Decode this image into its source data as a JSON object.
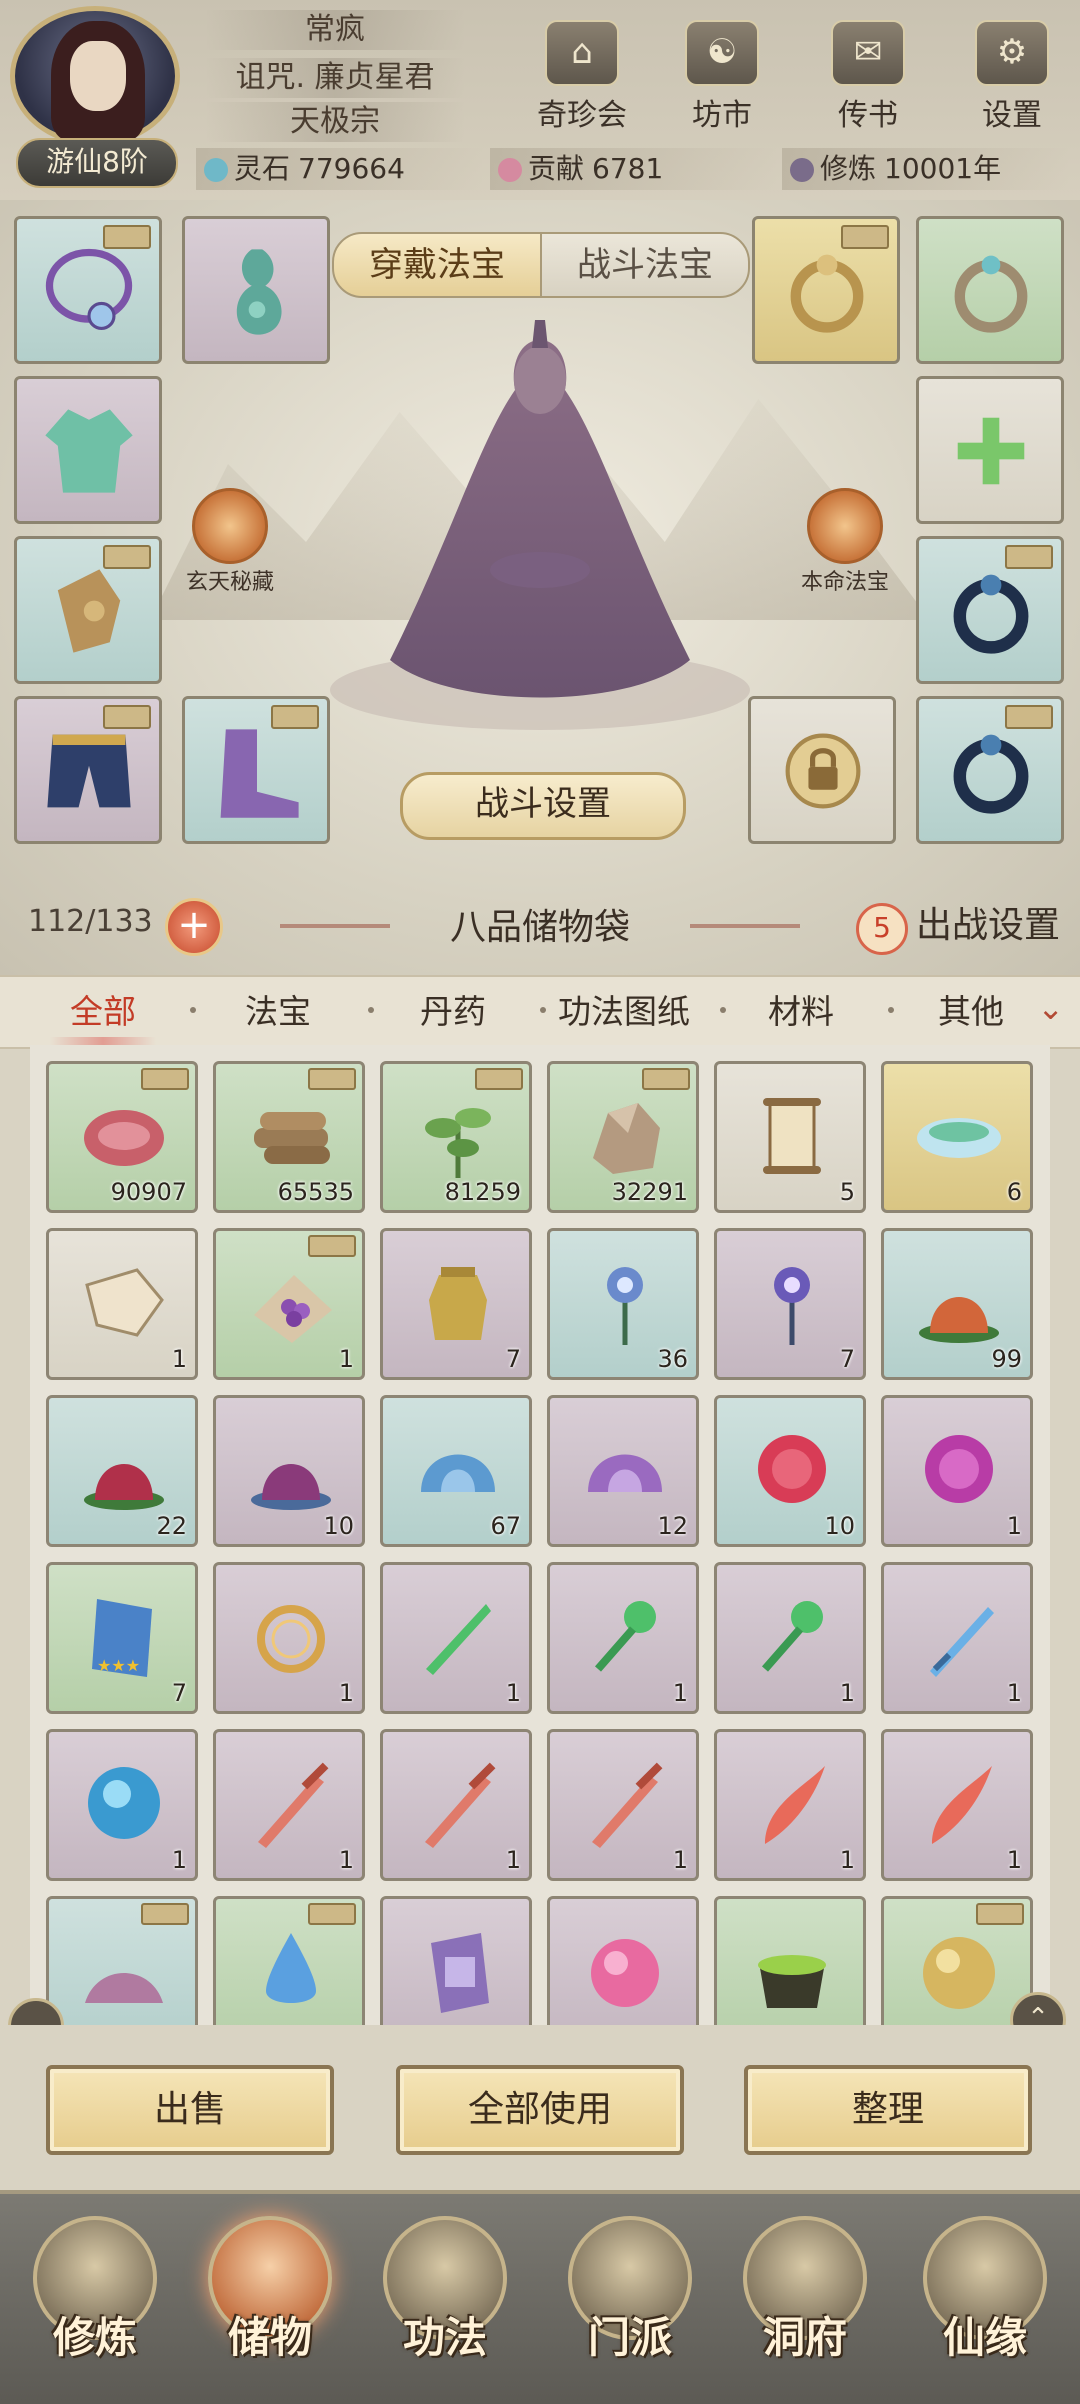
{
  "player": {
    "name": "常疯",
    "title": "诅咒. 廉贞星君",
    "sect": "天极宗",
    "rank": "游仙8阶"
  },
  "top_nav": [
    {
      "label": "奇珍会",
      "icon": "treasure-pavilion-icon"
    },
    {
      "label": "坊市",
      "icon": "market-icon"
    },
    {
      "label": "传书",
      "icon": "scroll-letter-icon"
    },
    {
      "label": "设置",
      "icon": "gear-icon"
    }
  ],
  "resources": [
    {
      "name": "灵石",
      "value": "779664",
      "color": "#6fb8c8"
    },
    {
      "name": "贡献",
      "value": "6781",
      "color": "#d58aa0"
    },
    {
      "name": "修炼",
      "value": "10001年",
      "color": "#7a6c8a"
    }
  ],
  "equip_tabs": {
    "active": "穿戴法宝",
    "inactive": "战斗法宝"
  },
  "equip_slots": {
    "necklace": "necklace-icon",
    "gourd": "gourd-icon",
    "robe": "robe-icon",
    "bracer": "bracer-icon",
    "pants": "pants-icon",
    "boots": "boots-icon",
    "ring_gold": "gold-ring-icon",
    "ring_plain": "ring-icon",
    "add": "+",
    "ring_dark1": "dark-ring-icon",
    "lock": "lock-icon",
    "ring_dark2": "dark-ring-icon"
  },
  "medals": {
    "left": "玄天秘藏",
    "right": "本命法宝"
  },
  "battle_settings": "战斗设置",
  "bag": {
    "capacity": "112/133",
    "title": "八品储物袋",
    "deploy_count": "5",
    "deploy_label": "出战设置"
  },
  "categories": {
    "items": [
      "全部",
      "法宝",
      "丹药",
      "功法图纸",
      "材料",
      "其他"
    ],
    "active_index": 0,
    "more_icon": "chevron-down-icon"
  },
  "items": [
    {
      "art": "meat",
      "count": "90907",
      "bg": "green",
      "tag": true
    },
    {
      "art": "logs",
      "count": "65535",
      "bg": "green",
      "tag": true
    },
    {
      "art": "herb",
      "count": "81259",
      "bg": "green",
      "tag": true
    },
    {
      "art": "ore",
      "count": "32291",
      "bg": "green",
      "tag": true
    },
    {
      "art": "scroll",
      "count": "5",
      "bg": "plain",
      "tag": false
    },
    {
      "art": "bowl",
      "count": "6",
      "bg": "gold",
      "tag": false
    },
    {
      "art": "talisman",
      "count": "1",
      "bg": "plain",
      "tag": false
    },
    {
      "art": "grapes",
      "count": "1",
      "bg": "green",
      "tag": true
    },
    {
      "art": "jar",
      "count": "7",
      "bg": "purple",
      "tag": false
    },
    {
      "art": "flower-blue",
      "count": "36",
      "bg": "blue",
      "tag": false
    },
    {
      "art": "flower-purple",
      "count": "7",
      "bg": "purple",
      "tag": false
    },
    {
      "art": "urchin-orange",
      "count": "99",
      "bg": "blue",
      "tag": false
    },
    {
      "art": "urchin-red",
      "count": "22",
      "bg": "blue",
      "tag": false
    },
    {
      "art": "urchin-purple",
      "count": "10",
      "bg": "purple",
      "tag": false
    },
    {
      "art": "shell-blue",
      "count": "67",
      "bg": "blue",
      "tag": false
    },
    {
      "art": "shell-purple",
      "count": "12",
      "bg": "purple",
      "tag": false
    },
    {
      "art": "spiky-red",
      "count": "10",
      "bg": "blue",
      "tag": false
    },
    {
      "art": "spiky-purple",
      "count": "1",
      "bg": "purple",
      "tag": false
    },
    {
      "art": "cloth-stars",
      "count": "7",
      "bg": "green",
      "tag": false
    },
    {
      "art": "gold-ring",
      "count": "1",
      "bg": "purple",
      "tag": false
    },
    {
      "art": "green-blade",
      "count": "1",
      "bg": "purple",
      "tag": false
    },
    {
      "art": "green-key",
      "count": "1",
      "bg": "purple",
      "tag": false
    },
    {
      "art": "green-key",
      "count": "1",
      "bg": "purple",
      "tag": false
    },
    {
      "art": "blue-sword",
      "count": "1",
      "bg": "purple",
      "tag": false
    },
    {
      "art": "blue-orb",
      "count": "1",
      "bg": "purple",
      "tag": false
    },
    {
      "art": "red-sword",
      "count": "1",
      "bg": "purple",
      "tag": false
    },
    {
      "art": "red-sword",
      "count": "1",
      "bg": "purple",
      "tag": false
    },
    {
      "art": "red-sword",
      "count": "1",
      "bg": "purple",
      "tag": false
    },
    {
      "art": "red-dagger",
      "count": "1",
      "bg": "purple",
      "tag": false
    },
    {
      "art": "red-dagger",
      "count": "1",
      "bg": "purple",
      "tag": false
    },
    {
      "art": "dust-pile",
      "count": "",
      "bg": "blue",
      "tag": true
    },
    {
      "art": "water-drop",
      "count": "",
      "bg": "green",
      "tag": true
    },
    {
      "art": "tablet",
      "count": "",
      "bg": "purple",
      "tag": false
    },
    {
      "art": "pink-pearl",
      "count": "",
      "bg": "purple",
      "tag": false
    },
    {
      "art": "cauldron",
      "count": "",
      "bg": "green",
      "tag": false
    },
    {
      "art": "gold-pearl",
      "count": "",
      "bg": "green",
      "tag": true
    }
  ],
  "actions": [
    "出售",
    "全部使用",
    "整理"
  ],
  "bottom_nav": {
    "items": [
      "修炼",
      "储物",
      "功法",
      "门派",
      "洞府",
      "仙缘"
    ],
    "active_index": 1
  }
}
